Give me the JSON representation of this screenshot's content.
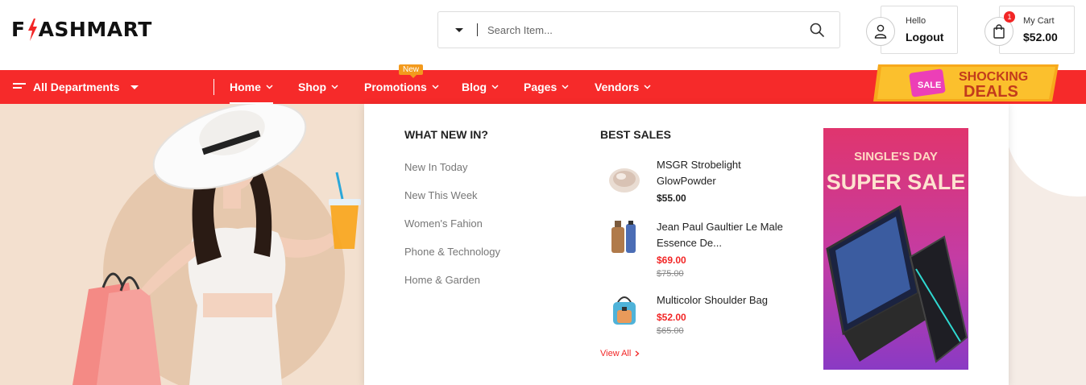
{
  "brand": {
    "logo_left": "F",
    "logo_right": "ASHMART",
    "accent": "#f62a2a"
  },
  "search": {
    "placeholder": "Search Item...",
    "value": "",
    "category_icon": "caret-down-icon",
    "button_icon": "search-icon"
  },
  "account": {
    "greeting": "Hello",
    "action": "Logout",
    "icon": "user-icon"
  },
  "cart": {
    "label": "My Cart",
    "total": "$52.00",
    "count": "1",
    "icon": "shopping-bag-icon"
  },
  "nav": {
    "departments": "All Departments",
    "items": [
      {
        "label": "Home",
        "active": true
      },
      {
        "label": "Shop"
      },
      {
        "label": "Promotions",
        "tag": "New"
      },
      {
        "label": "Blog"
      },
      {
        "label": "Pages"
      },
      {
        "label": "Vendors"
      }
    ],
    "banner": {
      "badge": "SALE",
      "line1": "SHOCKING",
      "line2": "DEALS"
    }
  },
  "mega_menu": {
    "whats_new": {
      "title": "WHAT NEW IN?",
      "links": [
        "New In Today",
        "New This Week",
        "Women's Fahion",
        "Phone & Technology",
        "Home & Garden"
      ]
    },
    "best_sales": {
      "title": "BEST SALES",
      "products": [
        {
          "name": "MSGR Strobelight GlowPowder",
          "price": "$55.00",
          "old_price": ""
        },
        {
          "name": "Jean Paul Gaultier Le Male Essence De...",
          "price": "$69.00",
          "old_price": "$75.00"
        },
        {
          "name": "Multicolor Shoulder Bag",
          "price": "$52.00",
          "old_price": "$65.00"
        }
      ],
      "view_all": "View All"
    },
    "promo": {
      "line1": "SINGLE'S DAY",
      "line2": "SUPER SALE"
    }
  }
}
